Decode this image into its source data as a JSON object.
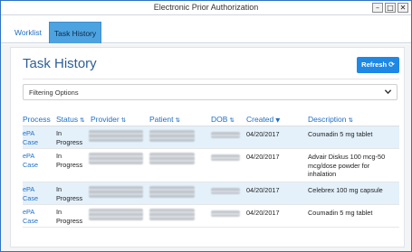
{
  "window": {
    "title": "Electronic Prior Authorization",
    "controls": [
      "minimize-icon",
      "maximize-icon",
      "close-icon"
    ]
  },
  "tabs": [
    {
      "label": "Worklist",
      "active": false
    },
    {
      "label": "Task History",
      "active": true
    }
  ],
  "page": {
    "title": "Task History",
    "refresh_label": "Refresh"
  },
  "filter": {
    "label": "Filtering Options"
  },
  "table": {
    "headers": {
      "process": "Process",
      "status": "Status",
      "provider": "Provider",
      "patient": "Patient",
      "dob": "DOB",
      "created": "Created",
      "description": "Description"
    },
    "rows": [
      {
        "process_1": "ePA",
        "process_2": "Case",
        "status_1": "In",
        "status_2": "Progress",
        "created": "04/20/2017",
        "description": "Coumadin 5 mg tablet"
      },
      {
        "process_1": "ePA",
        "process_2": "Case",
        "status_1": "In",
        "status_2": "Progress",
        "created": "04/20/2017",
        "description": "Advair Diskus 100 mcg-50 mcg/dose powder for inhalation"
      },
      {
        "process_1": "ePA",
        "process_2": "Case",
        "status_1": "In",
        "status_2": "Progress",
        "created": "04/20/2017",
        "description": "Celebrex 100 mg capsule"
      },
      {
        "process_1": "ePA",
        "process_2": "Case",
        "status_1": "In",
        "status_2": "Progress",
        "created": "04/20/2017",
        "description": "Coumadin 5 mg tablet"
      }
    ]
  },
  "colors": {
    "accent": "#1e88e5",
    "heading": "#2e5f96",
    "link": "#1f6fc5",
    "row_highlight": "#e4f1fb"
  }
}
